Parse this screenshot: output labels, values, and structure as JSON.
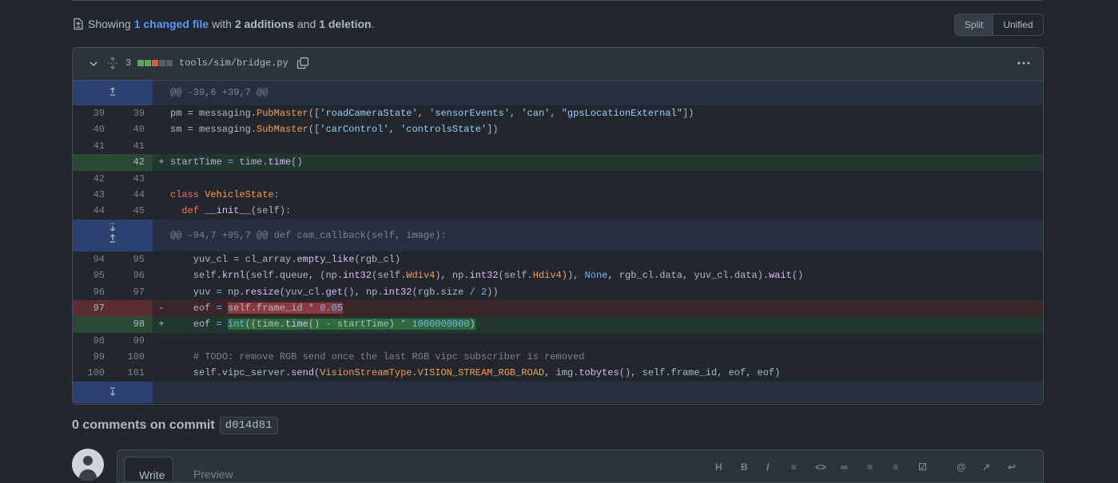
{
  "summary": {
    "prefix": "Showing",
    "files_link": "1 changed file",
    "with": "with",
    "additions": "2 additions",
    "and": "and",
    "deletions": "1 deletion",
    "period": "."
  },
  "view_toggle": {
    "split": "Split",
    "unified": "Unified"
  },
  "file": {
    "change_count": "3",
    "path": "tools/sim/bridge.py",
    "diffstat": [
      "#57ab5a",
      "#57ab5a",
      "#e5534b",
      "#545d68",
      "#545d68"
    ]
  },
  "hunks": [
    "@@ -39,6 +39,7 @@",
    "@@ -94,7 +95,7 @@ def cam_callback(self, image):"
  ],
  "lines": [
    {
      "old": "39",
      "new": "39"
    },
    {
      "old": "40",
      "new": "40"
    },
    {
      "old": "41",
      "new": "41"
    },
    {
      "old": "",
      "new": "42",
      "sign": "+"
    },
    {
      "old": "42",
      "new": "43"
    },
    {
      "old": "43",
      "new": "44"
    },
    {
      "old": "44",
      "new": "45"
    },
    {
      "old": "94",
      "new": "95"
    },
    {
      "old": "95",
      "new": "96"
    },
    {
      "old": "96",
      "new": "97"
    },
    {
      "old": "97",
      "new": "",
      "sign": "-"
    },
    {
      "old": "",
      "new": "98",
      "sign": "+"
    },
    {
      "old": "98",
      "new": "99"
    },
    {
      "old": "99",
      "new": "100"
    },
    {
      "old": "100",
      "new": "101"
    }
  ],
  "comments": {
    "title": "0 comments on commit",
    "sha": "d014d81"
  },
  "editor": {
    "write_tab": "Write",
    "preview_tab": "Preview"
  }
}
